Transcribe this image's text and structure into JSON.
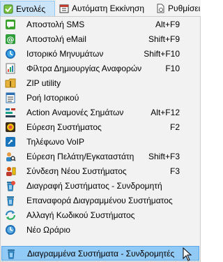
{
  "menubar": {
    "items": [
      {
        "label": "Εντολές",
        "icon": "commands-icon"
      },
      {
        "label": "Αυτόματη Εκκίνηση",
        "icon": "calendar-icon"
      },
      {
        "label": "Ρυθμίσει",
        "icon": "settings-doc-icon"
      }
    ]
  },
  "menu": {
    "items": [
      {
        "label": "Αποστολή SMS",
        "shortcut": "Alt+F9",
        "icon": "sms-icon"
      },
      {
        "label": "Αποστολή eMail",
        "shortcut": "Shift+F9",
        "icon": "email-icon"
      },
      {
        "label": "Ιστορικό Μηνυμάτων",
        "shortcut": "Shift+F10",
        "icon": "history-icon"
      },
      {
        "label": "Φίλτρα Δημιουργίας Αναφορών",
        "shortcut": "F10",
        "icon": "report-filter-icon"
      },
      {
        "label": "ZIP utility",
        "shortcut": "",
        "icon": "zip-icon"
      },
      {
        "label": "Ροή Ιστορικού",
        "shortcut": "",
        "icon": "history-flow-icon"
      },
      {
        "label": "Action Αναμονές Σημάτων",
        "shortcut": "Alt+F12",
        "icon": "action-queue-icon"
      },
      {
        "label": "Εύρεση Συστήματος",
        "shortcut": "F2",
        "icon": "find-system-icon"
      },
      {
        "label": "Τηλέφωνο VoIP",
        "shortcut": "",
        "icon": "voip-icon"
      },
      {
        "label": "Εύρεση Πελάτη/Εγκαταστάτη",
        "shortcut": "Shift+F3",
        "icon": "find-customer-icon"
      },
      {
        "label": "Σύνδεση Νέου Συστήματος",
        "shortcut": "F3",
        "icon": "connect-system-icon"
      },
      {
        "label": "Διαγραφή Συστήματος - Συνδρομητή",
        "shortcut": "",
        "icon": "delete-system-icon"
      },
      {
        "label": "Επαναφορά Διαγραμμένου Συστήματος",
        "shortcut": "",
        "icon": "restore-system-icon"
      },
      {
        "label": "Αλλαγή Κωδικού Συστήματος",
        "shortcut": "",
        "icon": "change-code-icon"
      },
      {
        "label": "Νέο Ωράριο",
        "shortcut": "",
        "icon": "schedule-icon"
      },
      {
        "label": "Διαγραμμένα Συστήματα - Συνδρομητές",
        "shortcut": "",
        "icon": "deleted-systems-icon"
      }
    ]
  },
  "colors": {
    "menubar_bg": "#f3f3f3",
    "active_menu_bg": "#cce4f7",
    "dropdown_bg": "#f2f2f2",
    "highlight_bg": "#91c9f7",
    "highlight_border": "#5aa7e8"
  }
}
